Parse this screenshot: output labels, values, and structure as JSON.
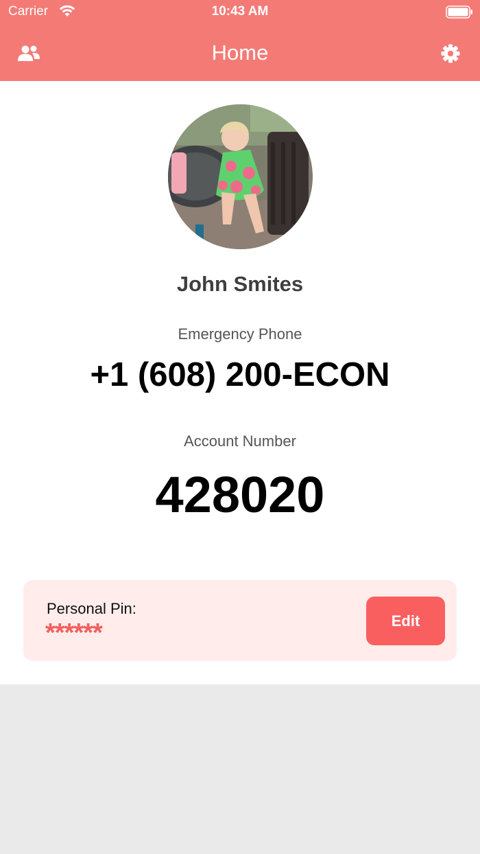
{
  "status_bar": {
    "carrier": "Carrier",
    "time": "10:43 AM"
  },
  "nav": {
    "title": "Home",
    "left_icon": "contacts-icon",
    "right_icon": "gear-icon"
  },
  "profile": {
    "name": "John Smites",
    "photo_icon": "avatar-photo"
  },
  "emergency": {
    "label": "Emergency Phone",
    "value": "+1 (608) 200-ECON"
  },
  "account": {
    "label": "Account Number",
    "value": "428020"
  },
  "pin": {
    "label": "Personal Pin:",
    "masked_value": "******",
    "edit_label": "Edit"
  },
  "colors": {
    "header": "#f47a76",
    "accent": "#fa5f5f",
    "pin_card": "#ffeceb",
    "background": "#eaeaea"
  }
}
